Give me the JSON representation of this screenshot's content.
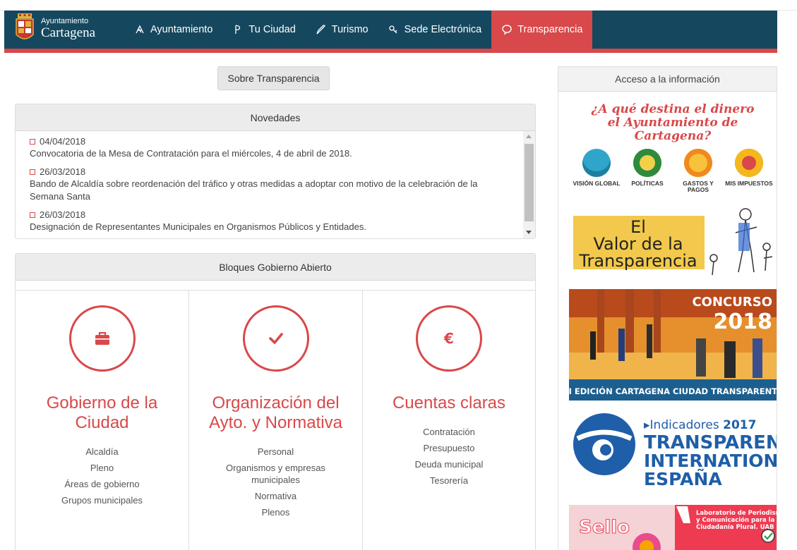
{
  "header": {
    "brand_small": "Ayuntamiento",
    "brand_big": "Cartagena",
    "nav": [
      {
        "label": "Ayuntamiento",
        "icon": "nav-ayuntamiento-icon"
      },
      {
        "label": "Tu Ciudad",
        "icon": "nav-ciudad-icon"
      },
      {
        "label": "Turismo",
        "icon": "nav-turismo-icon"
      },
      {
        "label": "Sede Electrónica",
        "icon": "nav-sede-icon"
      },
      {
        "label": "Transparencia",
        "icon": "chat-bubble-icon",
        "active": true
      }
    ],
    "colors": {
      "nav_bg": "#15485e",
      "accent": "#d9484a"
    }
  },
  "main": {
    "sobre_button": "Sobre Transparencia",
    "novedades": {
      "title": "Novedades",
      "items": [
        {
          "date": "04/04/2018",
          "text": "Convocatoria de la Mesa de Contratación para el miércoles, 4 de abril de 2018."
        },
        {
          "date": "26/03/2018",
          "text": "Bando de Alcaldía sobre reordenación del tráfico y otras medidas a adoptar con motivo de la celebración de la Semana Santa"
        },
        {
          "date": "26/03/2018",
          "text": "Designación de Representantes Municipales en Organismos Públicos y Entidades."
        }
      ]
    },
    "bloques": {
      "title": "Bloques Gobierno Abierto",
      "columns": [
        {
          "icon": "briefcase-icon",
          "title": "Gobierno de la Ciudad",
          "links": [
            "Alcaldía",
            "Pleno",
            "Áreas de gobierno",
            "Grupos municipales"
          ]
        },
        {
          "icon": "checkmark-icon",
          "title": "Organización del Ayto. y Normativa",
          "links": [
            "Personal",
            "Organismos y empresas municipales",
            "Normativa",
            "Plenos"
          ]
        },
        {
          "icon": "euro-icon",
          "title": "Cuentas claras",
          "links": [
            "Contratación",
            "Presupuesto",
            "Deuda municipal",
            "Tesorería"
          ]
        }
      ]
    }
  },
  "sidebar": {
    "title": "Acceso a la información",
    "banner_dinero": {
      "line1": "¿A qué destina el dinero",
      "line2": "el Ayuntamiento de Cartagena?",
      "items": [
        {
          "label": "VISIÓN GLOBAL",
          "color": "#2fa6c9"
        },
        {
          "label": "POLÍTICAS",
          "color": "#2e8b3e"
        },
        {
          "label": "GASTOS Y PAGOS",
          "color": "#f08a1c"
        },
        {
          "label": "MIS IMPUESTOS",
          "color": "#f5b81c"
        }
      ]
    },
    "banner_valor": {
      "line1": "El",
      "line2": "Valor de la",
      "line3": "Transparencia"
    },
    "banner_concurso": {
      "title": "CONCURSO",
      "year": "2018",
      "caption": "III EDICIÓN CARTAGENA CIUDAD TRANSPARENTE"
    },
    "banner_ti": {
      "line1_pre": "▸Indicadores ",
      "line1_year": "2017",
      "line2": "TRANSPARENCY",
      "line3": "INTERNATIONAL",
      "line4": "ESPAÑA"
    },
    "banner_sello": {
      "title": "Sello",
      "text1": "Laboratorio de Periodismo",
      "text2": "y Comunicación para la",
      "text3": "Ciudadanía Plural. UAB"
    }
  }
}
